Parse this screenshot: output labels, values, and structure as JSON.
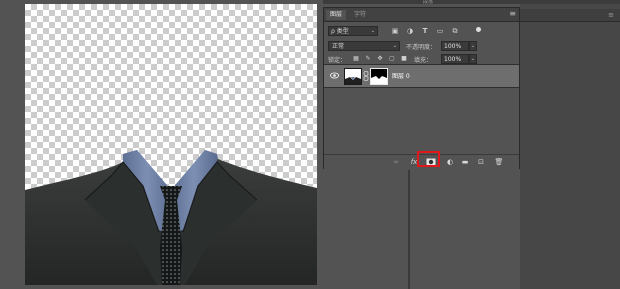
{
  "colors": {
    "panel_bg": "#535353",
    "highlight": "#e0181c",
    "selected_layer": "#6e6e6e"
  },
  "top_strip": {
    "label": "段落"
  },
  "panel": {
    "tabs": [
      {
        "label": "图层",
        "active": true
      },
      {
        "label": "字符",
        "active": false
      }
    ],
    "menu_icon": "panel-menu-icon",
    "filter": {
      "label": "ρ 类型",
      "caret": "⌄"
    },
    "filter_icons": [
      "image-filter-icon",
      "adjustment-filter-icon",
      "type-filter-icon",
      "shape-filter-icon",
      "smart-object-filter-icon"
    ],
    "blend_mode": {
      "value": "正常",
      "caret": "⌄"
    },
    "opacity": {
      "label": "不透明度：",
      "value": "100%"
    },
    "lock": {
      "label": "锁定："
    },
    "fill": {
      "label": "填充：",
      "value": "100%"
    },
    "layers": [
      {
        "name": "图层 0",
        "visible": true,
        "has_mask": true
      }
    ],
    "footer_icons": [
      "link-layers-icon",
      "fx-icon",
      "add-mask-icon",
      "adjustment-layer-icon",
      "group-folder-icon",
      "new-layer-icon",
      "delete-icon"
    ]
  }
}
